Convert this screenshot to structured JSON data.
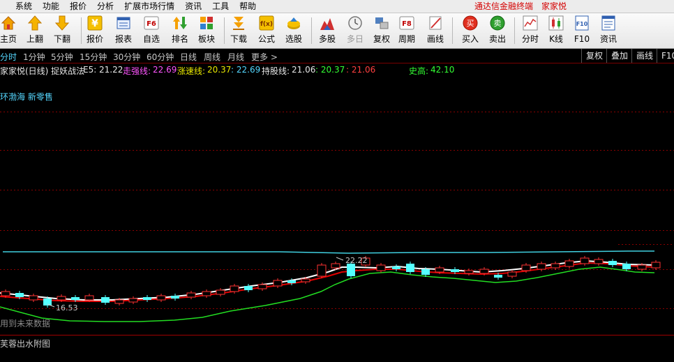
{
  "menu": {
    "items": [
      "系统",
      "功能",
      "报价",
      "分析",
      "扩展市场行情",
      "资讯",
      "工具",
      "帮助"
    ],
    "brand": "通达信金融终端",
    "stock_name": "家家悦"
  },
  "toolbar": {
    "home": "主页",
    "page_up": "上翻",
    "page_down": "下翻",
    "quote": "报价",
    "report": "报表",
    "watchlist": "自选",
    "ranking": "排名",
    "sector": "板块",
    "download": "下载",
    "formula": "公式",
    "stock_pick": "选股",
    "multi_stock": "多股",
    "multi_day": "多日",
    "adjust": "复权",
    "period": "周期",
    "draw": "画线",
    "buy": "买入",
    "sell": "卖出",
    "timeshare": "分时",
    "kline": "K线",
    "f10": "F10",
    "news": "资讯",
    "icon_f6": "F6",
    "icon_f8": "F8",
    "icon_buy": "买",
    "icon_sell": "卖",
    "icon_f10": "F10",
    "icon_yen": "¥",
    "icon_fx": "f(x)"
  },
  "periods": {
    "items": [
      "分时",
      "1分钟",
      "5分钟",
      "15分钟",
      "30分钟",
      "60分钟",
      "日线",
      "周线",
      "月线",
      "更多 >"
    ],
    "active": "分时",
    "right_buttons": [
      "复权",
      "叠加",
      "画线",
      "F10"
    ]
  },
  "indicators": {
    "title": "家家悦(日线) 捉妖战法",
    "e5_label": "E5:",
    "e5_value": "21.22",
    "strong_label": "走强线:",
    "strong_value": "22.69",
    "rise_label": "涨速线:",
    "rise_value": "20.37",
    "rise_value2": ": 22.69",
    "hold_label": "持股线:",
    "hold_value": "21.06",
    "hold_value2": ": 20.37",
    "hold_value3": ": 21.06",
    "high_label": "史高:",
    "high_value": "42.10"
  },
  "chart": {
    "sector_label": "环渤海 新零售",
    "max_price": "22.22",
    "min_price": "16.53",
    "future_warning": "用到未来数据",
    "sub_chart_label": "芙蓉出水附图"
  },
  "colors": {
    "up": "#ff3232",
    "down": "#55ffff",
    "white_line": "#ffffff",
    "red_line": "#e00000",
    "green_line": "#22dd22",
    "cyan_line": "#40d0e0",
    "magenta": "#ff55ff",
    "yellow": "#e8e800",
    "green": "#33ff33",
    "grid": "#8b0000"
  }
}
